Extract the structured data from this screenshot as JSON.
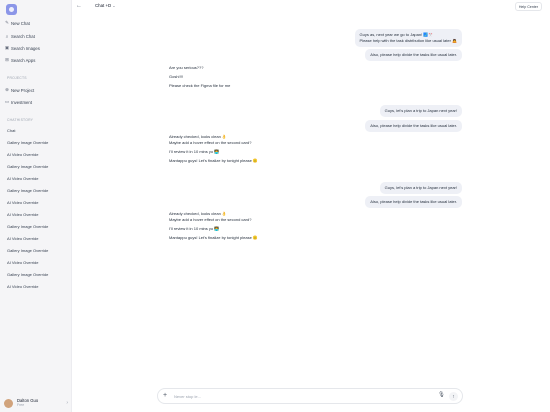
{
  "sidebar": {
    "nav": [
      {
        "label": "New Chat",
        "icon": "edit-icon"
      },
      {
        "label": "Search Chat",
        "icon": "search-icon"
      },
      {
        "label": "Search Images",
        "icon": "image-icon"
      },
      {
        "label": "Search Apps",
        "icon": "apps-icon"
      }
    ],
    "projects_label": "PROJECTS",
    "projects": [
      {
        "label": "New Project",
        "icon": "folder-plus-icon"
      },
      {
        "label": "Investment",
        "icon": "folder-icon"
      }
    ],
    "chats_label": "CHATHISTORY",
    "conversations": [
      "Chat",
      "Gallery Image Override",
      "AI Video Override",
      "Gallery Image Override",
      "AI Video Override",
      "Gallery Image Override",
      "AI Video Override",
      "AI Video Override",
      "Gallery Image Override",
      "AI Video Override",
      "Gallery Image Override",
      "AI Video Override",
      "Gallery Image Override",
      "AI Video Override"
    ],
    "profile": {
      "name": "Dalton Guo",
      "plan": "Free"
    }
  },
  "header": {
    "title": "Chat +D",
    "help": "Help Center"
  },
  "messages": {
    "u1_line1": "Guys as, next year we go to Japan! 🗾🎌",
    "u1_line2": "Please help with the task distribution like usual later 🙇",
    "u2": "Also, please help divide the tasks like usual later.",
    "a1_line1": "Are you serious???",
    "a1_line2": "Gosh!!!!",
    "a1_line3": "Please check the Figma file for me",
    "u3": "Guys, let's plan a trip to Japan next year!",
    "u4": "Also, please help divide the tasks like usual later.",
    "a2_line1": "Already checked, looks clean 👌",
    "a2_line2": "Maybe add a hover effect on the second card?",
    "a2_line3": "I'll review it in 10 mins yo 👨‍💻",
    "a2_line4": "Mantappu guys! Let's finalize by tonight please 🙂",
    "u5": "Guys, let's plan a trip to Japan next year!",
    "u6": "Also, please help divide the tasks like usual later.",
    "a3_line1": "Already checked, looks clean 👌",
    "a3_line2": "Maybe add a hover effect on the second card?",
    "a3_line3": "I'll review it in 10 mins yo 👨‍💻",
    "a3_line4": "Mantappu guys! Let's finalize by tonight please 🙂"
  },
  "composer": {
    "placeholder": "Never stop le..."
  },
  "colors": {
    "sidebar_bg": "#f5f5f7",
    "bubble_bg": "#eef0f6",
    "accent": "#8b96e8"
  }
}
